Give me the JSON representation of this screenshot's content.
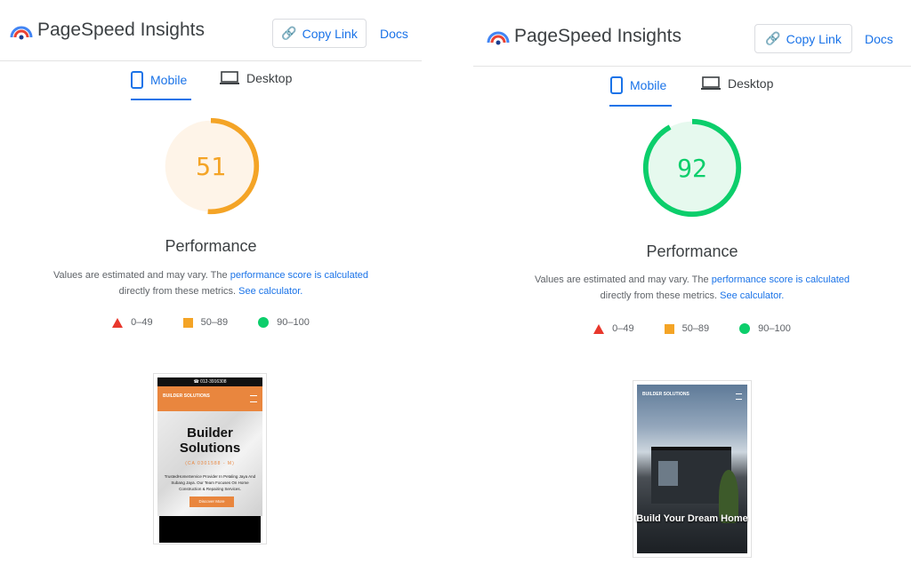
{
  "colors": {
    "accent": "#1a73e8",
    "fail": "#e8372c",
    "average": "#f4a426",
    "pass": "#0cce6b"
  },
  "panels": [
    {
      "brand": "PageSpeed Insights",
      "copy_link": "Copy Link",
      "docs": "Docs",
      "tab_mobile": "Mobile",
      "tab_desktop": "Desktop",
      "score": "51",
      "score_value": 0.51,
      "performance": "Performance",
      "note_1": "Values are estimated and may vary. The ",
      "note_link_1": "performance score is calculated",
      "note_2": "directly from these metrics. ",
      "note_link_2": "See calculator.",
      "legend": {
        "fail": "0–49",
        "average": "50–89",
        "pass": "90–100"
      },
      "preview": {
        "topbar": "012-3916308",
        "logo": "BUILDER SOLUTIONS",
        "heading": "Builder Solutions",
        "subheading": "(CA 0301588 - M)",
        "paragraph": "TrustedHomeService Provider In Petaling Jaya And Subang Jaya. Our Team Focuses On Home Construction & Repairing Services.",
        "button": "Discover More"
      }
    },
    {
      "brand": "PageSpeed Insights",
      "copy_link": "Copy Link",
      "docs": "Docs",
      "tab_mobile": "Mobile",
      "tab_desktop": "Desktop",
      "score": "92",
      "score_value": 0.92,
      "performance": "Performance",
      "note_1": "Values are estimated and may vary. The ",
      "note_link_1": "performance score is calculated",
      "note_2": "directly from these metrics. ",
      "note_link_2": "See calculator.",
      "legend": {
        "fail": "0–49",
        "average": "50–89",
        "pass": "90–100"
      },
      "preview": {
        "logo": "BUILDER SOLUTIONS",
        "heading": "Build Your Dream Home"
      }
    }
  ]
}
